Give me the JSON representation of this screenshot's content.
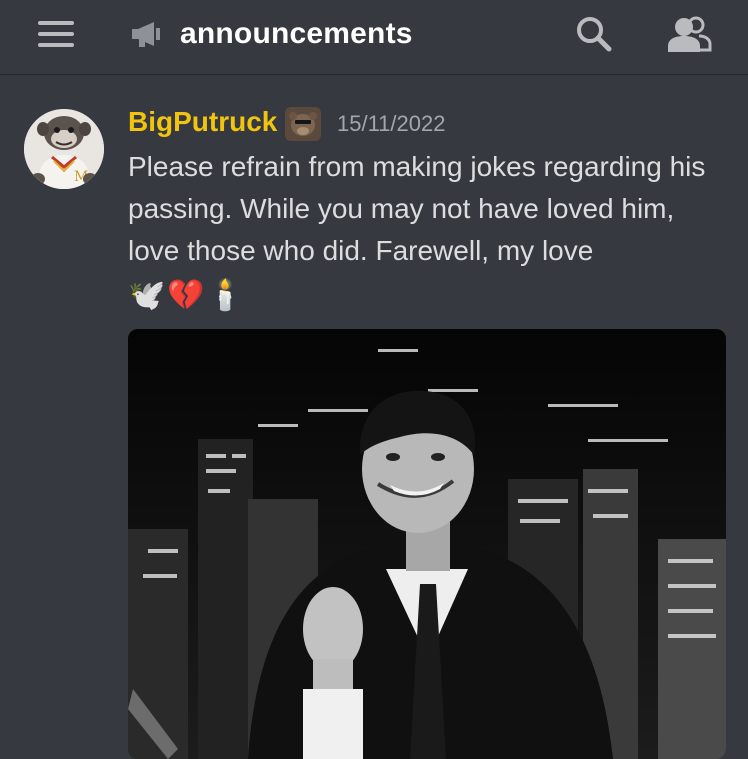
{
  "header": {
    "channel_name": "announcements",
    "menu_icon": "hamburger-menu-icon",
    "channel_icon": "announcement-megaphone-icon",
    "search_icon": "search-icon",
    "members_icon": "members-icon"
  },
  "message": {
    "author": "BigPutruck",
    "author_color": "#f1c40f",
    "timestamp": "15/11/2022",
    "text": "Please refrain from making jokes regarding his passing. While you may not have loved him, love those who did. Farewell, my love",
    "emojis": "🕊️💔🕯️",
    "attachment_icon": "photo-attachment-image"
  },
  "colors": {
    "background": "#36393f",
    "text": "#dcddde",
    "muted": "#a3a6aa"
  }
}
